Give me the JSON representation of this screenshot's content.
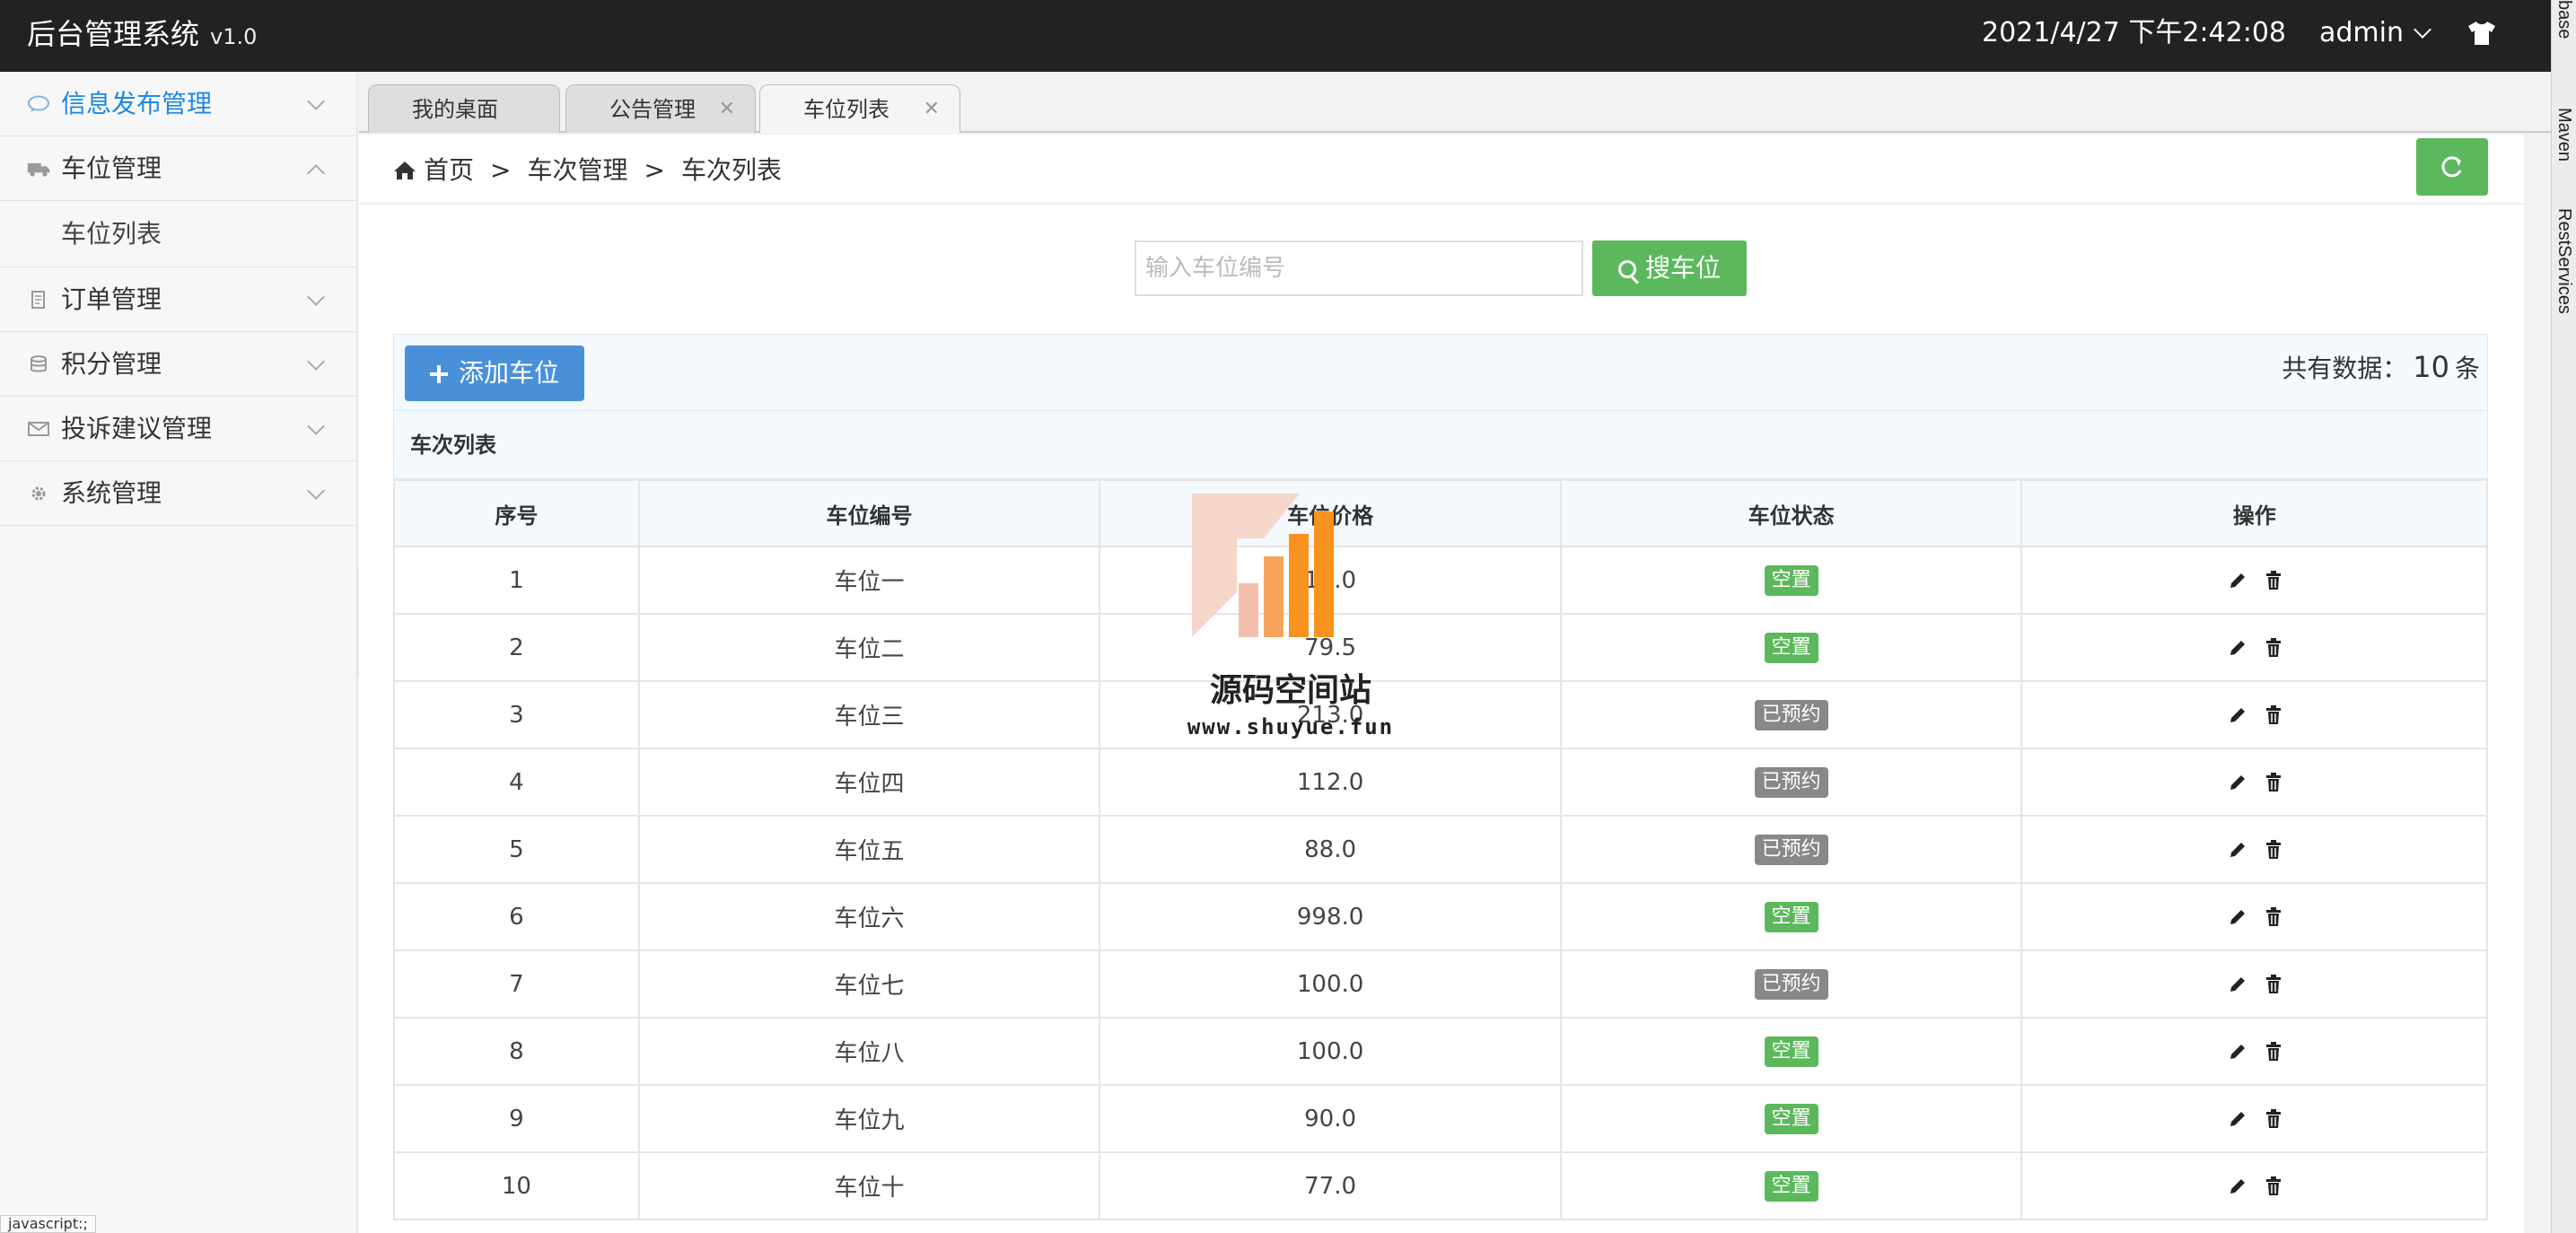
{
  "app": {
    "title": "后台管理系统",
    "version": "v1.0"
  },
  "header": {
    "datetime": "2021/4/27 下午2:42:08",
    "user": "admin"
  },
  "ide": {
    "items": [
      "Maven",
      "RestServices"
    ],
    "top_label": "base"
  },
  "sidebar": {
    "items": [
      {
        "label": "信息发布管理",
        "icon": "chat-icon",
        "active": true
      },
      {
        "label": "车位管理",
        "icon": "truck-icon",
        "expanded": true,
        "children": [
          {
            "label": "车位列表"
          }
        ]
      },
      {
        "label": "订单管理",
        "icon": "document-icon"
      },
      {
        "label": "积分管理",
        "icon": "database-icon"
      },
      {
        "label": "投诉建议管理",
        "icon": "envelope-icon"
      },
      {
        "label": "系统管理",
        "icon": "gear-icon"
      }
    ]
  },
  "tabs": [
    {
      "label": "我的桌面"
    },
    {
      "label": "公告管理"
    },
    {
      "label": "车位列表",
      "active": true
    }
  ],
  "breadcrumb": [
    "首页",
    "车次管理",
    "车次列表"
  ],
  "breadcrumb_sep": ">",
  "search": {
    "placeholder": "输入车位编号",
    "value": "",
    "button": "搜车位"
  },
  "toolbar": {
    "add_label": "添加车位",
    "total_prefix": "共有数据：",
    "total_count": "10",
    "total_suffix": "条"
  },
  "table": {
    "caption": "车次列表",
    "headers": [
      "序号",
      "车位编号",
      "车位价格",
      "车位状态",
      "操作"
    ],
    "rows": [
      {
        "no": "1",
        "code": "车位一",
        "price": "10.0",
        "status": "空置"
      },
      {
        "no": "2",
        "code": "车位二",
        "price": "79.5",
        "status": "空置"
      },
      {
        "no": "3",
        "code": "车位三",
        "price": "213.0",
        "status": "已预约"
      },
      {
        "no": "4",
        "code": "车位四",
        "price": "112.0",
        "status": "已预约"
      },
      {
        "no": "5",
        "code": "车位五",
        "price": "88.0",
        "status": "已预约"
      },
      {
        "no": "6",
        "code": "车位六",
        "price": "998.0",
        "status": "空置"
      },
      {
        "no": "7",
        "code": "车位七",
        "price": "100.0",
        "status": "已预约"
      },
      {
        "no": "8",
        "code": "车位八",
        "price": "100.0",
        "status": "空置"
      },
      {
        "no": "9",
        "code": "车位九",
        "price": "90.0",
        "status": "空置"
      },
      {
        "no": "10",
        "code": "车位十",
        "price": "77.0",
        "status": "空置"
      }
    ]
  },
  "watermark": {
    "title": "源码空间站",
    "url": "www.shuyue.fun"
  },
  "statusbar": {
    "text": "javascript:;"
  },
  "colors": {
    "accent": "#1e88e5",
    "success": "#5cb85c",
    "primary": "#4a90d9",
    "muted": "#888888",
    "topbar": "#222222"
  }
}
